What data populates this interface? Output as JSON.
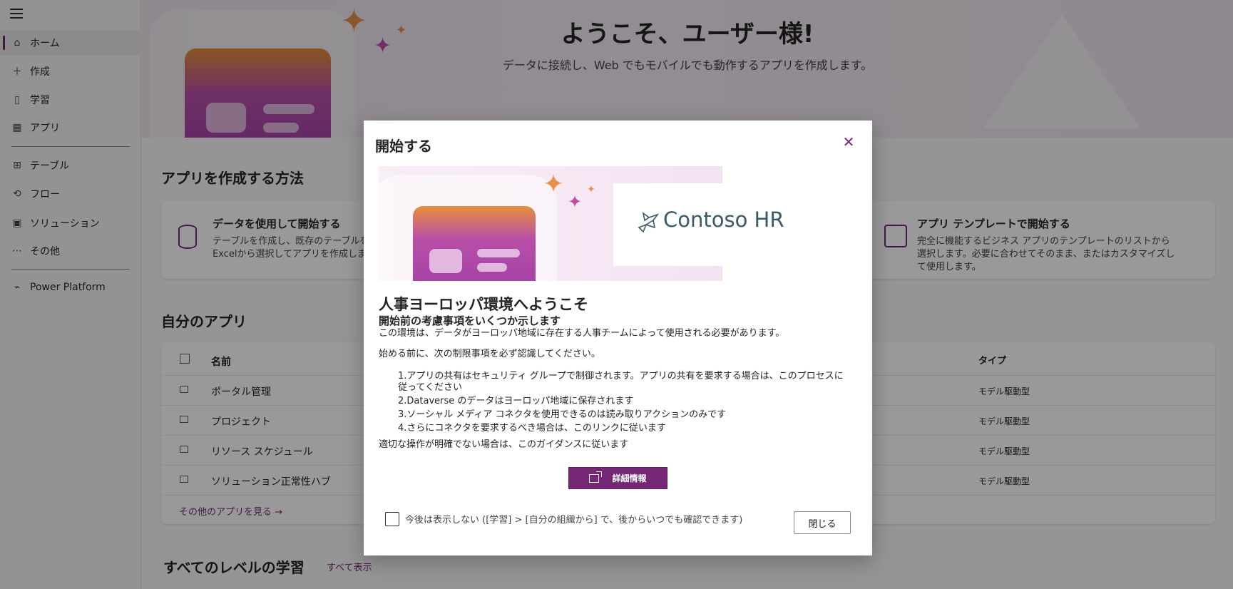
{
  "sidebar": {
    "items": [
      {
        "label": "ホーム",
        "icon": "home-icon"
      },
      {
        "label": "作成",
        "icon": "plus-icon"
      },
      {
        "label": "学習",
        "icon": "book-icon"
      },
      {
        "label": "アプリ",
        "icon": "apps-icon"
      },
      {
        "label": "テーブル",
        "icon": "table-icon"
      },
      {
        "label": "フロー",
        "icon": "flow-icon"
      },
      {
        "label": "ソリューション",
        "icon": "solution-icon"
      },
      {
        "label": "その他",
        "icon": "more-icon"
      },
      {
        "label": "Power Platform",
        "icon": "power-platform-icon"
      }
    ]
  },
  "hero": {
    "title": "ようこそ、ユーザー様!",
    "subtitle": "データに接続し、Web でもモバイルでも動作するアプリを作成します。"
  },
  "create_section": {
    "title": "アプリを作成する方法",
    "card_data": {
      "title": "データを使用して開始する",
      "desc_line1": "テーブルを作成し、既存のテーブルを",
      "desc_line2": "Excelから選択してアプリを作成します。"
    },
    "card_template": {
      "title": "アプリ テンプレートで開始する",
      "desc_line1": "完全に機能するビジネス アプリのテンプレートのリストから",
      "desc_line2": "選択します。必要に合わせてそのまま、またはカスタマイズし",
      "desc_line3": "て使用します。"
    }
  },
  "my_apps": {
    "title": "自分のアプリ",
    "col_name": "名前",
    "col_type": "タイプ",
    "rows": [
      {
        "name": "ポータル管理",
        "type": "モデル駆動型"
      },
      {
        "name": "プロジェクト",
        "type": "モデル駆動型"
      },
      {
        "name": "リソース スケジュール",
        "type": "モデル駆動型"
      },
      {
        "name": "ソリューション正常性ハブ",
        "type": "モデル駆動型"
      }
    ],
    "see_more": "その他のアプリを見る →"
  },
  "learning": {
    "title": "すべてのレベルの学習",
    "see_all": "すべて表示"
  },
  "dialog": {
    "title": "開始する",
    "close_glyph": "✕",
    "logo_text": "Contoso HR",
    "heading": "人事ヨーロッパ環境へようこそ",
    "subheading": "開始前の考慮事項をいくつか示します",
    "intro": "この環境は、データがヨーロッパ地域に存在する人事チームによって使用される必要があります。",
    "before": "始める前に、次の制限事項を必ず認識してください。",
    "list": [
      "1.アプリの共有はセキュリティ グループで制御されます。アプリの共有を要求する場合は、このプロセスに",
      "従ってください",
      "2.Dataverse のデータはヨーロッパ地域に保存されます",
      "3.ソーシャル メディア コネクタを使用できるのは読み取りアクションのみです",
      "4.さらにコネクタを要求するべき場合は、このリンクに従います"
    ],
    "guidance": "適切な操作が明確でない場合は、このガイダンスに従います",
    "more_button": "詳細情報",
    "checkbox_label": "今後は表示しない ([学習] > [自分の組織から] で、後からいつでも確認できます)",
    "close_button": "閉じる"
  },
  "colors": {
    "accent": "#742774",
    "overlay": "rgba(0,0,0,0.4)"
  }
}
